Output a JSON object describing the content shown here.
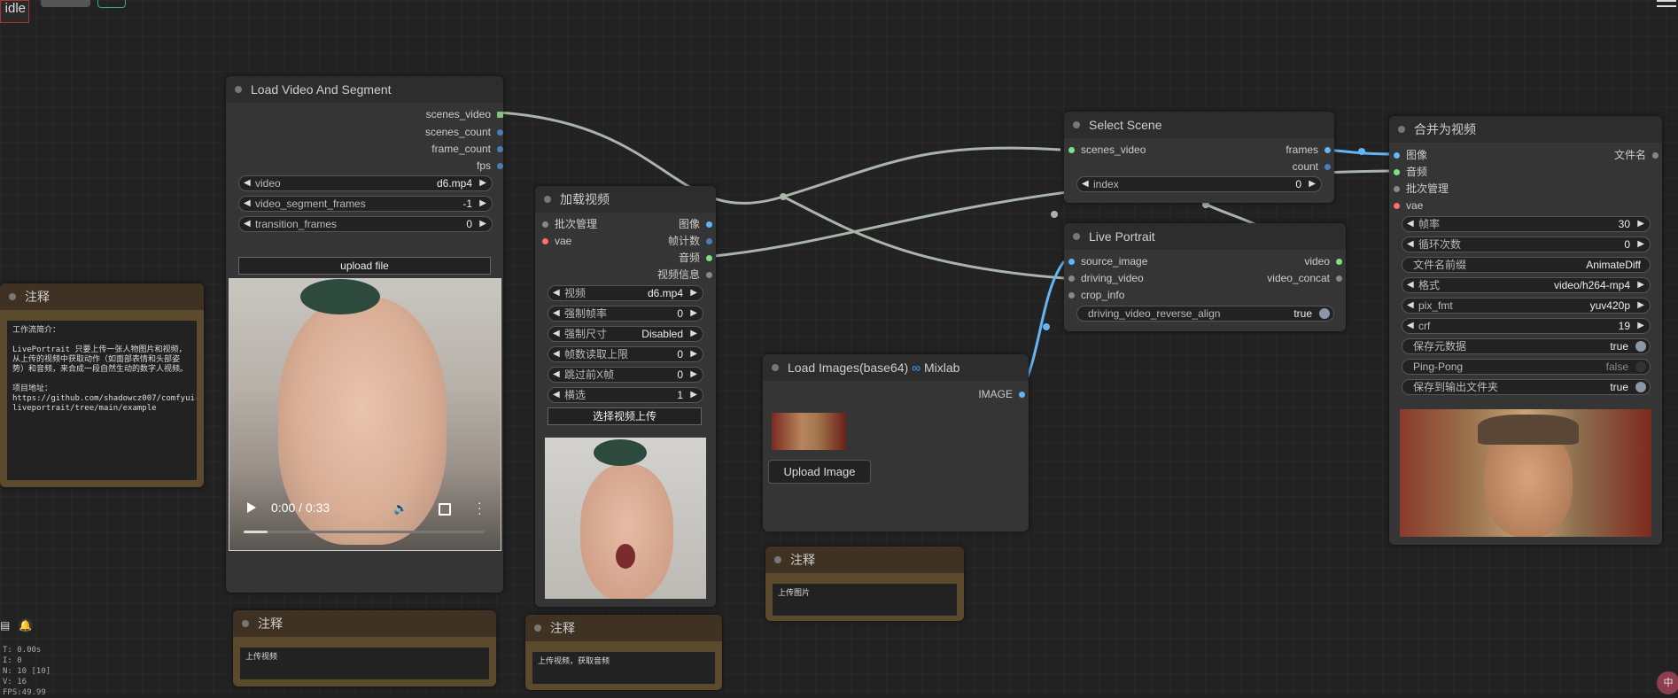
{
  "top_bar": {
    "queue_label": "idle"
  },
  "nodes": {
    "load_video_segment": {
      "title": "Load Video And Segment",
      "outputs": [
        "scenes_video",
        "scenes_count",
        "frame_count",
        "fps"
      ],
      "widgets": [
        {
          "label": "video",
          "value": "d6.mp4"
        },
        {
          "label": "video_segment_frames",
          "value": "-1"
        },
        {
          "label": "transition_frames",
          "value": "0"
        }
      ],
      "upload_label": "upload file",
      "player": {
        "time": "0:00 / 0:33",
        "progress": 0.1
      }
    },
    "load_video_cn": {
      "title": "加载视频",
      "inputs": [
        "批次管理",
        "vae"
      ],
      "outputs": [
        "图像",
        "帧计数",
        "音频",
        "视频信息"
      ],
      "widgets": [
        {
          "label": "视频",
          "value": "d6.mp4"
        },
        {
          "label": "强制帧率",
          "value": "0"
        },
        {
          "label": "强制尺寸",
          "value": "Disabled"
        },
        {
          "label": "帧数读取上限",
          "value": "0"
        },
        {
          "label": "跳过前X帧",
          "value": "0"
        },
        {
          "label": "横选",
          "value": "1"
        }
      ],
      "upload_label": "选择视频上传"
    },
    "select_scene": {
      "title": "Select Scene",
      "input": "scenes_video",
      "outputs": [
        "frames",
        "count"
      ],
      "widget": {
        "label": "index",
        "value": "0"
      }
    },
    "live_portrait": {
      "title": "Live Portrait",
      "inputs": [
        "source_image",
        "driving_video",
        "crop_info"
      ],
      "outputs": [
        "video",
        "video_concat"
      ],
      "toggle": {
        "label": "driving_video_reverse_align",
        "value": "true"
      }
    },
    "load_images_b64": {
      "title": "Load Images(base64)",
      "brand_symbol": "∞",
      "brand": "Mixlab",
      "output": "IMAGE",
      "button": "Upload Image"
    },
    "combine_video": {
      "title": "合并为视频",
      "inputs": [
        "图像",
        "音频",
        "批次管理",
        "vae"
      ],
      "output": "文件名",
      "widgets": [
        {
          "label": "帧率",
          "value": "30"
        },
        {
          "label": "循环次数",
          "value": "0"
        }
      ],
      "text_widget": {
        "label": "文件名前缀",
        "value": "AnimateDiff"
      },
      "widgets2": [
        {
          "label": "格式",
          "value": "video/h264-mp4"
        },
        {
          "label": "pix_fmt",
          "value": "yuv420p"
        },
        {
          "label": "crf",
          "value": "19"
        }
      ],
      "toggles": [
        {
          "label": "保存元数据",
          "value": "true",
          "on": true
        },
        {
          "label": "Ping-Pong",
          "value": "false",
          "on": false
        },
        {
          "label": "保存到输出文件夹",
          "value": "true",
          "on": true
        }
      ]
    }
  },
  "notes": [
    {
      "title": "注释",
      "text": "工作流简介：\n\nLivePortrait 只要上传一张人物图片和视频，从上传的视频中获取动作（如面部表情和头部姿势）和音频，来合成一段自然生动的数字人视频。\n\n项目地址：\nhttps://github.com/shadowcz007/comfyui-liveportrait/tree/main/example"
    },
    {
      "title": "注释",
      "text": "上传视频"
    },
    {
      "title": "注释",
      "text": "上传视频，获取音频"
    },
    {
      "title": "注释",
      "text": "上传图片"
    }
  ],
  "stats": [
    "T: 0.00s",
    "I: 0",
    "N: 10 [10]",
    "V: 16",
    "FPS:49.99"
  ],
  "corner_badge": "中",
  "colors": {
    "image": "#64b5f6",
    "audio": "#7ee07e",
    "vae": "#ff6e6e",
    "int": "#4a7fb5",
    "wire": "#a8b5a8"
  }
}
